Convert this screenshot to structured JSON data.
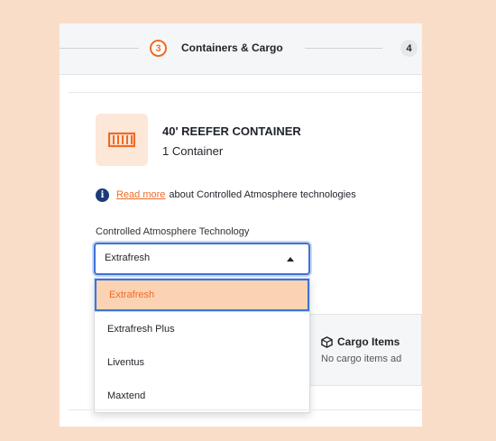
{
  "stepper": {
    "active_number": "3",
    "active_label": "Containers & Cargo",
    "next_number": "4"
  },
  "container": {
    "title": "40' REEFER CONTAINER",
    "count": "1 Container",
    "icon": "reefer-container-icon"
  },
  "info": {
    "link_text": "Read more",
    "text": "about Controlled Atmosphere technologies"
  },
  "ca_field": {
    "label": "Controlled Atmosphere Technology",
    "value": "Extrafresh",
    "options": [
      "Extrafresh",
      "Extrafresh Plus",
      "Liventus",
      "Maxtend"
    ]
  },
  "cargo": {
    "title": "Cargo Items",
    "empty_text": "No cargo items ad"
  },
  "colors": {
    "accent": "#f06a23",
    "focus": "#3f73d3",
    "page_bg": "#f9ddc9"
  }
}
